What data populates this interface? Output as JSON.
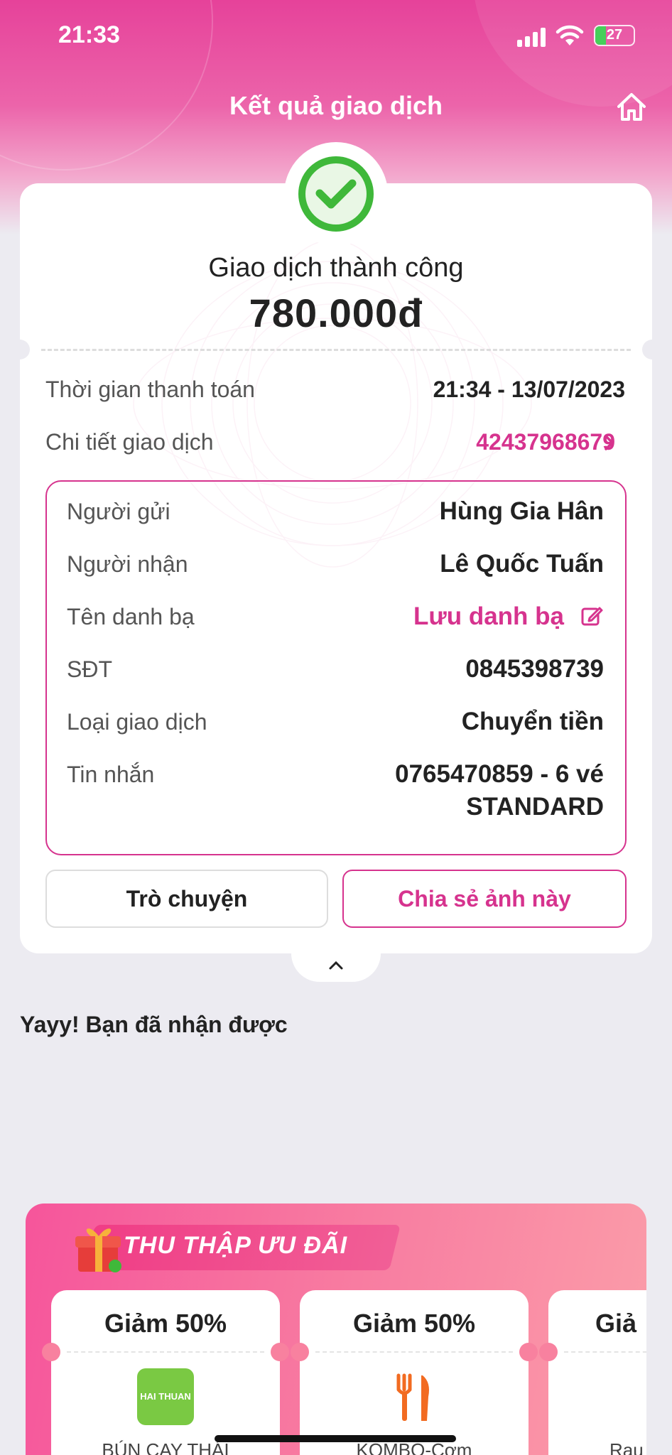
{
  "status_bar": {
    "time": "21:33",
    "battery_level": "27"
  },
  "header": {
    "title": "Kết quả giao dịch",
    "home_icon": "home-icon"
  },
  "result": {
    "status": "Giao dịch thành công",
    "amount": "780.000đ",
    "success_icon": "check-circle-icon"
  },
  "summary_rows": [
    {
      "label": "Thời gian thanh toán",
      "value": "21:34 - 13/07/2023"
    },
    {
      "label": "Chi tiết giao dịch",
      "value": "42437968679"
    }
  ],
  "details": [
    {
      "label": "Người gửi",
      "value": "Hùng Gia Hân"
    },
    {
      "label": "Người nhận",
      "value": "Lê Quốc Tuấn"
    },
    {
      "label": "Tên danh bạ",
      "value": "Lưu danh bạ"
    },
    {
      "label": "SĐT",
      "value": "0845398739"
    },
    {
      "label": "Loại giao dịch",
      "value": "Chuyển tiền"
    },
    {
      "label": "Tin nhắn",
      "value_line1": "0765470859 - 6 vé",
      "value_line2": "STANDARD"
    }
  ],
  "buttons": {
    "chat": "Trò chuyện",
    "share": "Chia sẻ ảnh này"
  },
  "collapse_icon": "chevron-up-icon",
  "rewards": {
    "title": "Yayy! Bạn đã nhận được"
  },
  "promo": {
    "banner": "THU THẬP ƯU ĐÃI",
    "coupons": [
      {
        "title": "Giảm 50%",
        "name": "BÚN CAY THÁI",
        "logo_text": "HAI THUAN"
      },
      {
        "title": "Giảm 50%",
        "name": "KOMBO-Cơm",
        "icon": "fork-knife-icon"
      },
      {
        "title": "Giả",
        "name": "Rau"
      }
    ]
  },
  "colors": {
    "brand": "#d6338e",
    "header_pink": "#e6429a",
    "success_green": "#3fb83a"
  }
}
